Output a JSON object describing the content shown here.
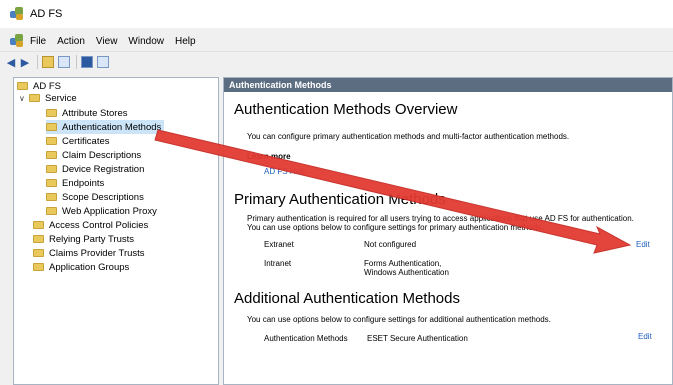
{
  "window": {
    "title": "AD FS"
  },
  "menu": [
    "File",
    "Action",
    "View",
    "Window",
    "Help"
  ],
  "tree": {
    "root": "AD FS",
    "service": "Service",
    "service_children": [
      "Attribute Stores",
      "Authentication Methods",
      "Certificates",
      "Claim Descriptions",
      "Device Registration",
      "Endpoints",
      "Scope Descriptions",
      "Web Application Proxy"
    ],
    "top_level": [
      "Access Control Policies",
      "Relying Party Trusts",
      "Claims Provider Trusts",
      "Application Groups"
    ],
    "selected": "Authentication Methods"
  },
  "content": {
    "header": "Authentication Methods",
    "overview_title": "Authentication Methods Overview",
    "overview_text": "You can configure primary authentication methods and multi-factor authentication methods.",
    "learn_more": "Learn more",
    "help_link": "AD FS Help",
    "primary_title": "Primary Authentication Methods",
    "primary_text_1": "Primary authentication is required for all users trying to access applications that use AD FS for authentication.",
    "primary_text_2": "You can use options below to configure settings for primary authentication methods.",
    "extranet_label": "Extranet",
    "extranet_value": "Not configured",
    "intranet_label": "Intranet",
    "intranet_value_1": "Forms Authentication,",
    "intranet_value_2": "Windows Authentication",
    "edit_label": "Edit",
    "additional_title": "Additional Authentication Methods",
    "additional_text": "You can use options below to configure settings for additional authentication methods.",
    "auth_methods_label": "Authentication Methods",
    "auth_methods_value": "ESET Secure Authentication",
    "edit_label_2": "Edit"
  },
  "colors": {
    "annotation_arrow": "#e23a32",
    "header_bar": "#5c6d82",
    "link": "#1f5fbf"
  }
}
